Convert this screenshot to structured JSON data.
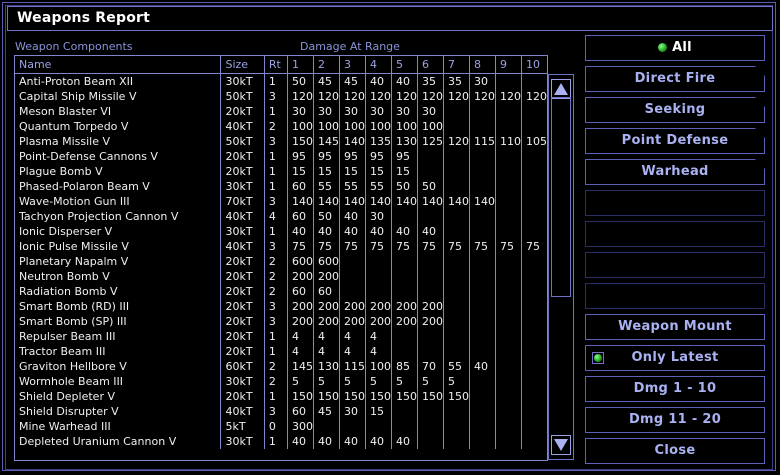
{
  "window": {
    "title": "Weapons Report"
  },
  "headers": {
    "components": "Weapon Components",
    "damage": "Damage At Range"
  },
  "columns": [
    "Name",
    "Size",
    "Rt",
    "1",
    "2",
    "3",
    "4",
    "5",
    "6",
    "7",
    "8",
    "9",
    "10"
  ],
  "rows": [
    [
      "Anti-Proton Beam XII",
      "30kT",
      "1",
      "50",
      "45",
      "45",
      "40",
      "40",
      "35",
      "35",
      "30",
      "",
      ""
    ],
    [
      "Capital Ship Missile V",
      "50kT",
      "3",
      "120",
      "120",
      "120",
      "120",
      "120",
      "120",
      "120",
      "120",
      "120",
      "120"
    ],
    [
      "Meson Blaster VI",
      "20kT",
      "1",
      "30",
      "30",
      "30",
      "30",
      "30",
      "30",
      "",
      "",
      "",
      ""
    ],
    [
      "Quantum Torpedo V",
      "40kT",
      "2",
      "100",
      "100",
      "100",
      "100",
      "100",
      "100",
      "",
      "",
      "",
      ""
    ],
    [
      "Plasma Missile V",
      "50kT",
      "3",
      "150",
      "145",
      "140",
      "135",
      "130",
      "125",
      "120",
      "115",
      "110",
      "105"
    ],
    [
      "Point-Defense Cannons V",
      "20kT",
      "1",
      "95",
      "95",
      "95",
      "95",
      "95",
      "",
      "",
      "",
      "",
      ""
    ],
    [
      "Plague Bomb V",
      "20kT",
      "1",
      "15",
      "15",
      "15",
      "15",
      "15",
      "",
      "",
      "",
      "",
      ""
    ],
    [
      "Phased-Polaron Beam V",
      "30kT",
      "1",
      "60",
      "55",
      "55",
      "55",
      "50",
      "50",
      "",
      "",
      "",
      ""
    ],
    [
      "Wave-Motion Gun III",
      "70kT",
      "3",
      "140",
      "140",
      "140",
      "140",
      "140",
      "140",
      "140",
      "140",
      "",
      ""
    ],
    [
      "Tachyon Projection Cannon V",
      "40kT",
      "4",
      "60",
      "50",
      "40",
      "30",
      "",
      "",
      "",
      "",
      "",
      ""
    ],
    [
      "Ionic Disperser V",
      "30kT",
      "1",
      "40",
      "40",
      "40",
      "40",
      "40",
      "40",
      "",
      "",
      "",
      ""
    ],
    [
      "Ionic Pulse Missile V",
      "40kT",
      "3",
      "75",
      "75",
      "75",
      "75",
      "75",
      "75",
      "75",
      "75",
      "75",
      "75"
    ],
    [
      "Planetary Napalm V",
      "20kT",
      "2",
      "600",
      "600",
      "",
      "",
      "",
      "",
      "",
      "",
      "",
      ""
    ],
    [
      "Neutron Bomb V",
      "20kT",
      "2",
      "200",
      "200",
      "",
      "",
      "",
      "",
      "",
      "",
      "",
      ""
    ],
    [
      "Radiation Bomb V",
      "20kT",
      "2",
      "60",
      "60",
      "",
      "",
      "",
      "",
      "",
      "",
      "",
      ""
    ],
    [
      "Smart Bomb (RD) III",
      "20kT",
      "3",
      "200",
      "200",
      "200",
      "200",
      "200",
      "200",
      "",
      "",
      "",
      ""
    ],
    [
      "Smart Bomb (SP) III",
      "20kT",
      "3",
      "200",
      "200",
      "200",
      "200",
      "200",
      "200",
      "",
      "",
      "",
      ""
    ],
    [
      "Repulser Beam III",
      "20kT",
      "1",
      "4",
      "4",
      "4",
      "4",
      "",
      "",
      "",
      "",
      "",
      ""
    ],
    [
      "Tractor Beam III",
      "20kT",
      "1",
      "4",
      "4",
      "4",
      "4",
      "",
      "",
      "",
      "",
      "",
      ""
    ],
    [
      "Graviton Hellbore V",
      "60kT",
      "2",
      "145",
      "130",
      "115",
      "100",
      "85",
      "70",
      "55",
      "40",
      "",
      ""
    ],
    [
      "Wormhole Beam III",
      "30kT",
      "2",
      "5",
      "5",
      "5",
      "5",
      "5",
      "5",
      "5",
      "",
      "",
      ""
    ],
    [
      "Shield Depleter V",
      "20kT",
      "1",
      "150",
      "150",
      "150",
      "150",
      "150",
      "150",
      "150",
      "",
      "",
      ""
    ],
    [
      "Shield Disrupter V",
      "40kT",
      "3",
      "60",
      "45",
      "30",
      "15",
      "",
      "",
      "",
      "",
      "",
      ""
    ],
    [
      "Mine Warhead III",
      "5kT",
      "0",
      "300",
      "",
      "",
      "",
      "",
      "",
      "",
      "",
      "",
      ""
    ],
    [
      "Depleted Uranium Cannon V",
      "30kT",
      "1",
      "40",
      "40",
      "40",
      "40",
      "40",
      "",
      "",
      "",
      "",
      ""
    ]
  ],
  "buttons": {
    "all": "All",
    "direct_fire": "Direct Fire",
    "seeking": "Seeking",
    "point_defense": "Point Defense",
    "warhead": "Warhead",
    "weapon_mount": "Weapon Mount",
    "only_latest": "Only Latest",
    "dmg_1_10": "Dmg 1 - 10",
    "dmg_11_20": "Dmg 11 - 20",
    "close": "Close"
  },
  "colors": {
    "border": "#5c61b8",
    "label": "#a9b1f0",
    "led": "#1fa01f"
  }
}
